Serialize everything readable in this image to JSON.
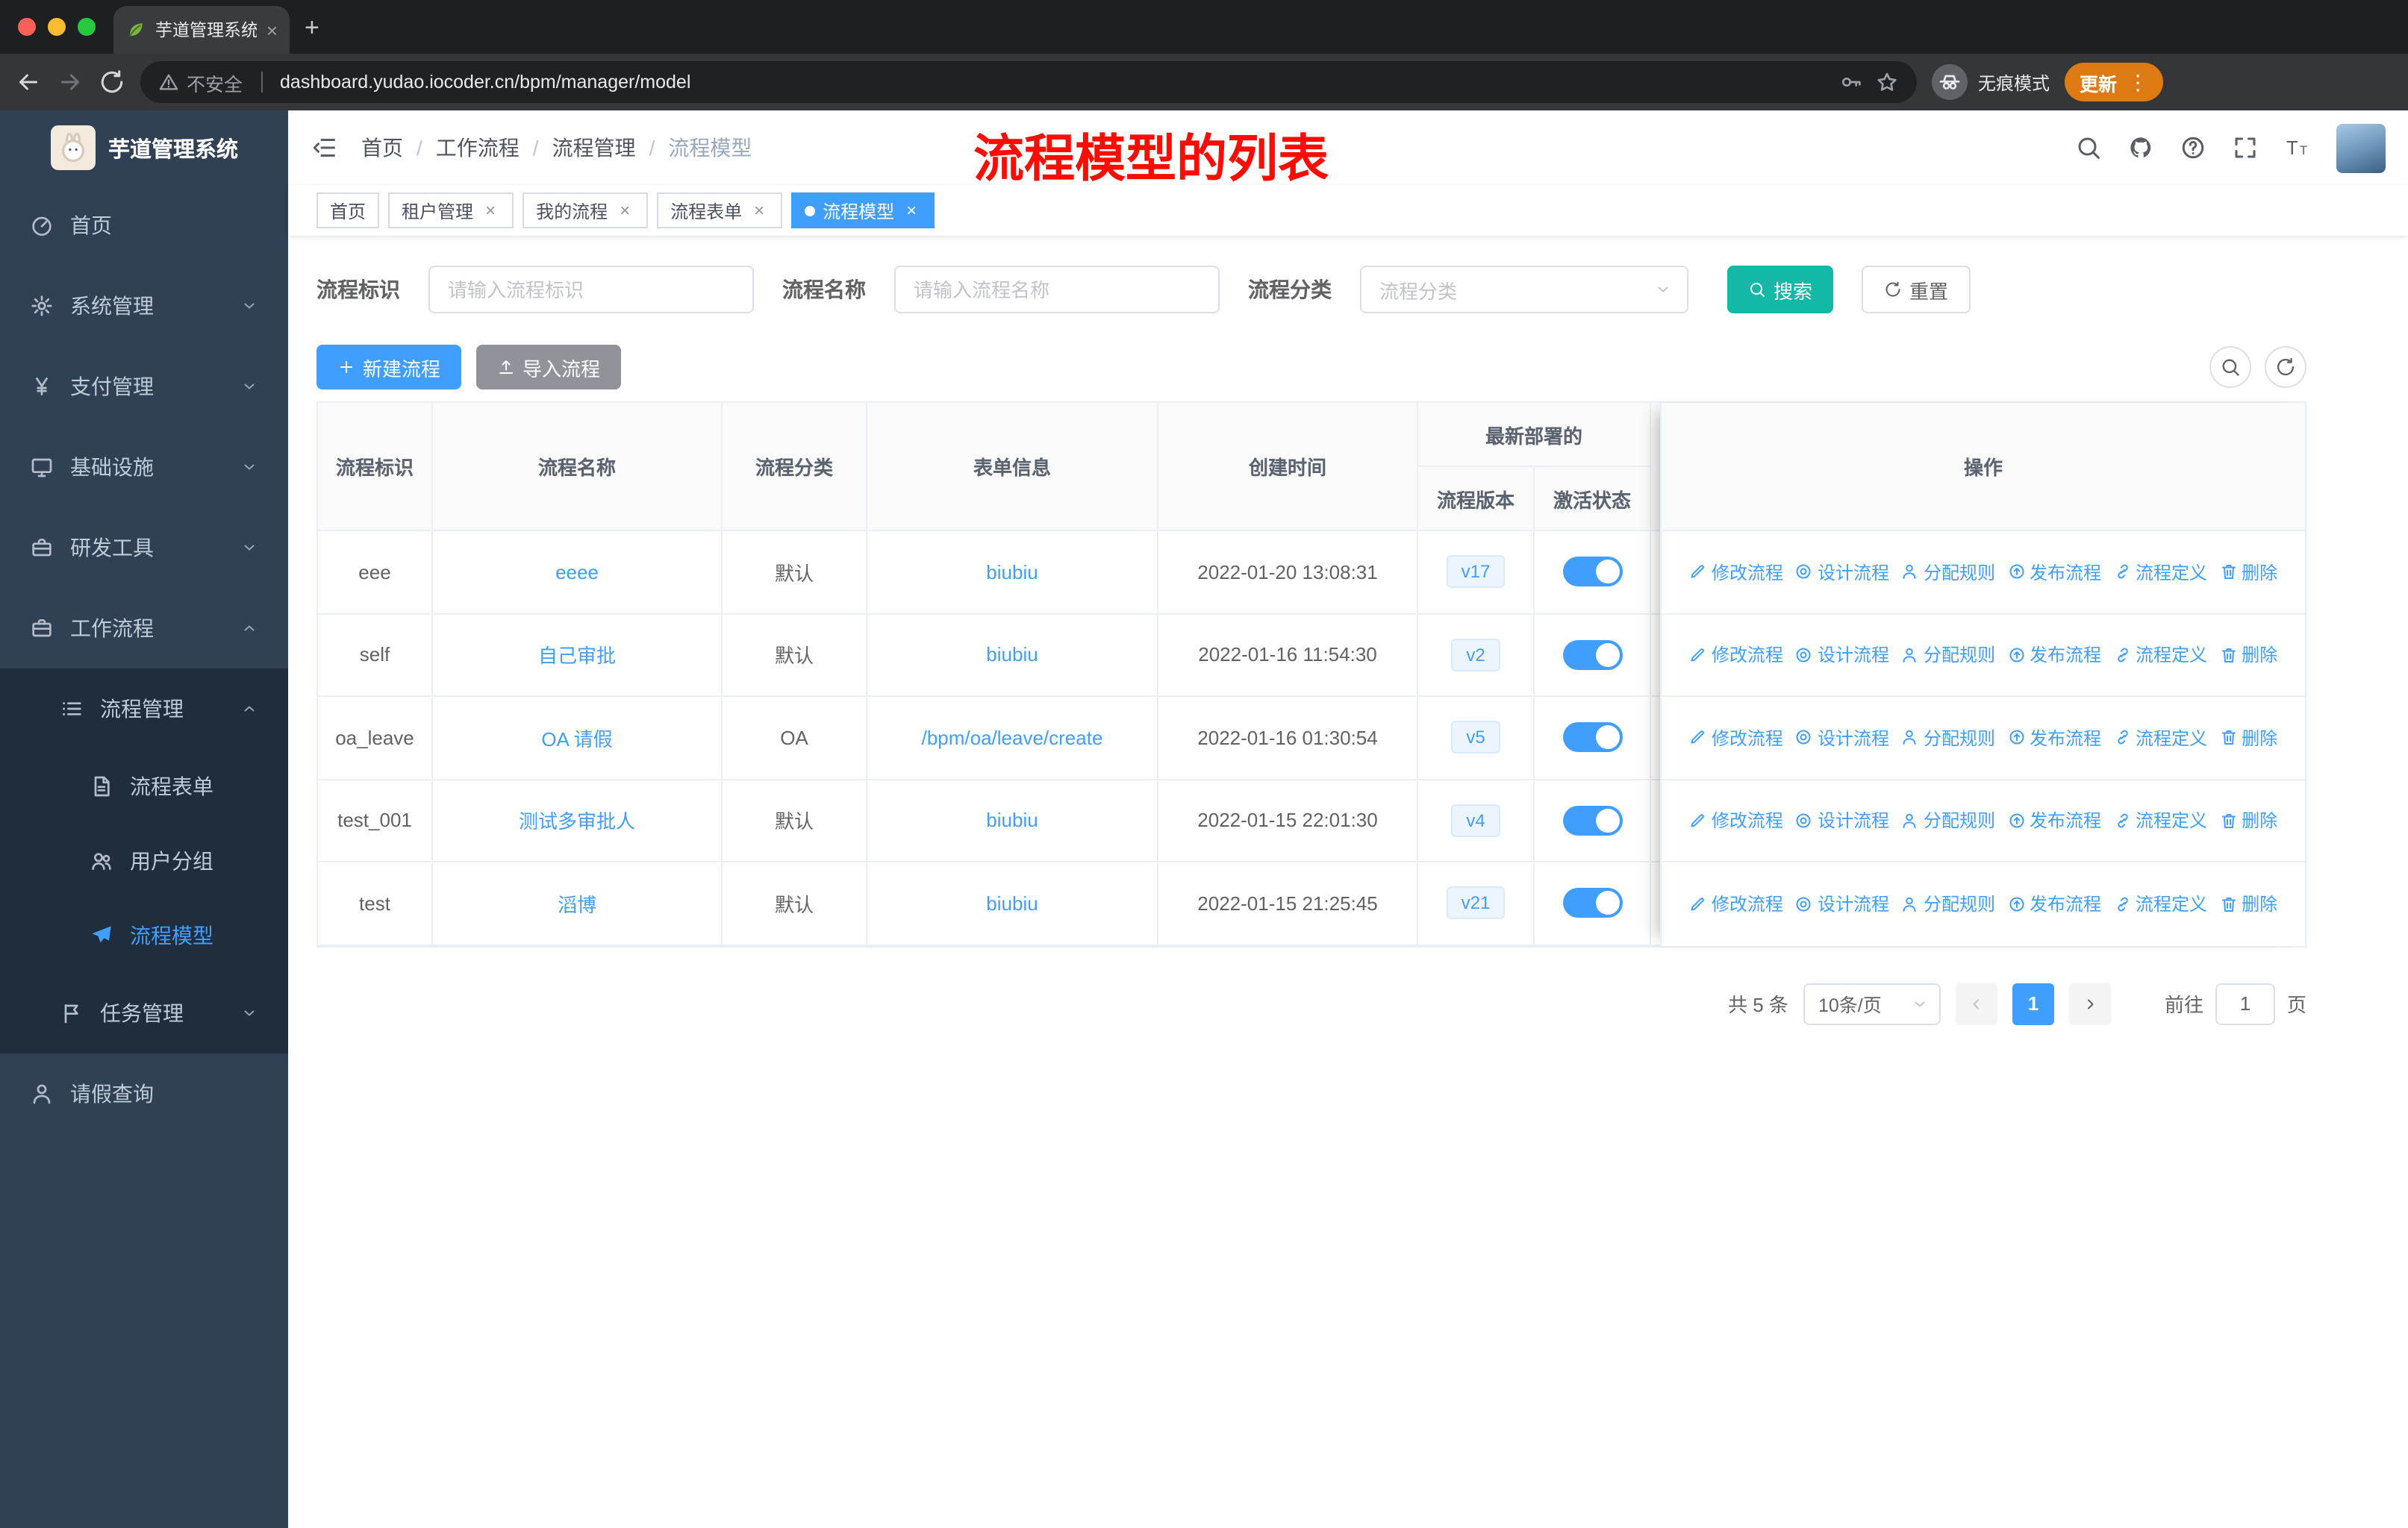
{
  "colors": {
    "accent": "#409eff",
    "search_button": "#14b8a6",
    "annotation_red": "#fe0b02",
    "sidebar_bg": "#304156",
    "submenu_bg": "#1f2d3d",
    "update_pill": "#dd7a12"
  },
  "glyphs": {
    "close": "×",
    "plus": "+",
    "dots": "⋮",
    "question": "?"
  },
  "browser": {
    "tab": {
      "title": "芋道管理系统"
    },
    "address": {
      "security": "不安全",
      "url": "dashboard.yudao.iocoder.cn/bpm/manager/model"
    },
    "incognito_label": "无痕模式",
    "update_label": "更新"
  },
  "icons": {
    "favicon": "leaf-icon",
    "address_left": "warning-triangle-icon",
    "address_right": [
      "key-icon",
      "star-icon"
    ],
    "header_right": [
      "search-icon",
      "github-icon",
      "help-icon",
      "fullscreen-icon",
      "font-size-icon"
    ],
    "toolbar_right": [
      "search-icon",
      "refresh-icon"
    ]
  },
  "sidebar": {
    "title": "芋道管理系统",
    "items": [
      {
        "label": "首页",
        "icon": "gauge-icon"
      },
      {
        "label": "系统管理",
        "icon": "gear-icon"
      },
      {
        "label": "支付管理",
        "icon": "yen-icon"
      },
      {
        "label": "基础设施",
        "icon": "monitor-icon"
      },
      {
        "label": "研发工具",
        "icon": "toolbox-icon"
      },
      {
        "label": "工作流程",
        "icon": "briefcase-icon"
      }
    ],
    "submenu": {
      "process_management": "流程管理",
      "children": [
        {
          "label": "流程表单",
          "icon": "document-icon"
        },
        {
          "label": "用户分组",
          "icon": "users-icon"
        },
        {
          "label": "流程模型",
          "icon": "send-icon",
          "active": true
        }
      ],
      "task_management": "任务管理"
    },
    "leave_query": "请假查询"
  },
  "header": {
    "breadcrumb": [
      "首页",
      "工作流程",
      "流程管理",
      "流程模型"
    ],
    "separator": "/",
    "annotation": "流程模型的列表"
  },
  "tags": [
    {
      "label": "首页"
    },
    {
      "label": "租户管理"
    },
    {
      "label": "我的流程"
    },
    {
      "label": "流程表单"
    },
    {
      "label": "流程模型"
    }
  ],
  "filters": {
    "key_label": "流程标识",
    "key_placeholder": "请输入流程标识",
    "name_label": "流程名称",
    "name_placeholder": "请输入流程名称",
    "category_label": "流程分类",
    "category_placeholder": "流程分类",
    "search_label": "搜索",
    "reset_label": "重置"
  },
  "toolbar": {
    "create_label": "新建流程",
    "import_label": "导入流程"
  },
  "table": {
    "headers": {
      "key": "流程标识",
      "name": "流程名称",
      "category": "流程分类",
      "form": "表单信息",
      "create_time": "创建时间",
      "deploy_group": "最新部署的",
      "version": "流程版本",
      "status": "激活状态",
      "actions": "操作"
    },
    "action_labels": [
      "修改流程",
      "设计流程",
      "分配规则",
      "发布流程",
      "流程定义",
      "删除"
    ],
    "action_icons": [
      "edit-icon",
      "design-icon",
      "assign-icon",
      "publish-icon",
      "definition-icon",
      "delete-icon"
    ],
    "rows": [
      {
        "key": "eee",
        "name": "eeee",
        "category": "默认",
        "form": "biubiu",
        "created": "2022-01-20 13:08:31",
        "version": "v17",
        "active": true
      },
      {
        "key": "self",
        "name": "自己审批",
        "category": "默认",
        "form": "biubiu",
        "created": "2022-01-16 11:54:30",
        "version": "v2",
        "active": true
      },
      {
        "key": "oa_leave",
        "name": "OA 请假",
        "category": "OA",
        "form": "/bpm/oa/leave/create",
        "created": "2022-01-16 01:30:54",
        "version": "v5",
        "active": true
      },
      {
        "key": "test_001",
        "name": "测试多审批人",
        "category": "默认",
        "form": "biubiu",
        "created": "2022-01-15 22:01:30",
        "version": "v4",
        "active": true
      },
      {
        "key": "test",
        "name": "滔博",
        "category": "默认",
        "form": "biubiu",
        "created": "2022-01-15 21:25:45",
        "version": "v21",
        "active": true
      }
    ]
  },
  "pagination": {
    "total": "共 5 条",
    "page_size": "10条/页",
    "page": "1",
    "goto_label": "前往",
    "goto_value": "1",
    "page_word": "页"
  }
}
